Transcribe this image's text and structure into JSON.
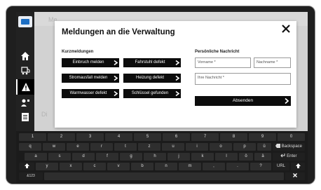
{
  "modal": {
    "title": "Meldungen an die Verwaltung",
    "quick_label": "Kurzmeldungen",
    "message_label": "Persönliche Nachricht",
    "quick_buttons": [
      "Einbruch melden",
      "Fahrstuhl defekt",
      "Stromausfall melden",
      "Heizung defekt",
      "Warmwasser defekt",
      "Schlüssel gefunden"
    ],
    "firstname_placeholder": "Vorname *",
    "lastname_placeholder": "Nachname *",
    "message_placeholder": "Ihre Nachricht *",
    "send_label": "Absenden"
  },
  "background": {
    "fragments": [
      "Me",
      "Di"
    ]
  },
  "keyboard": {
    "row1": [
      "1",
      "2",
      "3",
      "4",
      "5",
      "6",
      "7",
      "8",
      "9",
      "0"
    ],
    "row2": [
      "q",
      "w",
      "e",
      "r",
      "t",
      "z",
      "u",
      "i",
      "o",
      "p",
      "ü"
    ],
    "backspace": "Backspace",
    "row3": [
      "a",
      "s",
      "d",
      "f",
      "g",
      "h",
      "j",
      "k",
      "l",
      "ö",
      "ä"
    ],
    "enter": "Enter",
    "row4": [
      "y",
      "x",
      "c",
      "v",
      "b",
      "n",
      "m",
      ",",
      ".",
      "?"
    ],
    "url": "URL",
    "mode": "&123"
  },
  "colors": {
    "accent": "#1d6fc4",
    "button": "#0c0c0c"
  }
}
